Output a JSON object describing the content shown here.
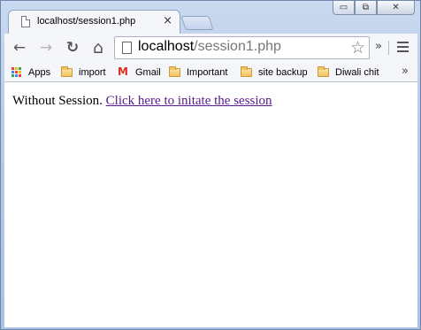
{
  "window": {
    "controls": {
      "minimize": "▭",
      "restore": "⧉",
      "close": "✕"
    }
  },
  "tab": {
    "title": "localhost/session1.php",
    "close_glyph": "×"
  },
  "toolbar": {
    "back_glyph": "←",
    "forward_glyph": "→",
    "reload_glyph": "↻",
    "home_glyph": "⌂",
    "url_host": "localhost",
    "url_path": "/session1.php",
    "star_glyph": "☆",
    "extensions_more": "»"
  },
  "bookmarks": {
    "items": [
      {
        "label": "Apps",
        "icon": "apps-icon"
      },
      {
        "label": "import",
        "icon": "folder-icon"
      },
      {
        "label": "Gmail",
        "icon": "gmail-icon"
      },
      {
        "label": "Important",
        "icon": "folder-icon"
      },
      {
        "label": "site backup",
        "icon": "folder-icon"
      },
      {
        "label": "Diwali chit",
        "icon": "folder-icon"
      }
    ],
    "more": "»",
    "gmail_glyph": "M"
  },
  "page": {
    "text": "Without Session.",
    "link": "Click here to initate the session"
  },
  "colors": {
    "link_visited": "#551a8b",
    "frame": "#b6cbe9"
  }
}
